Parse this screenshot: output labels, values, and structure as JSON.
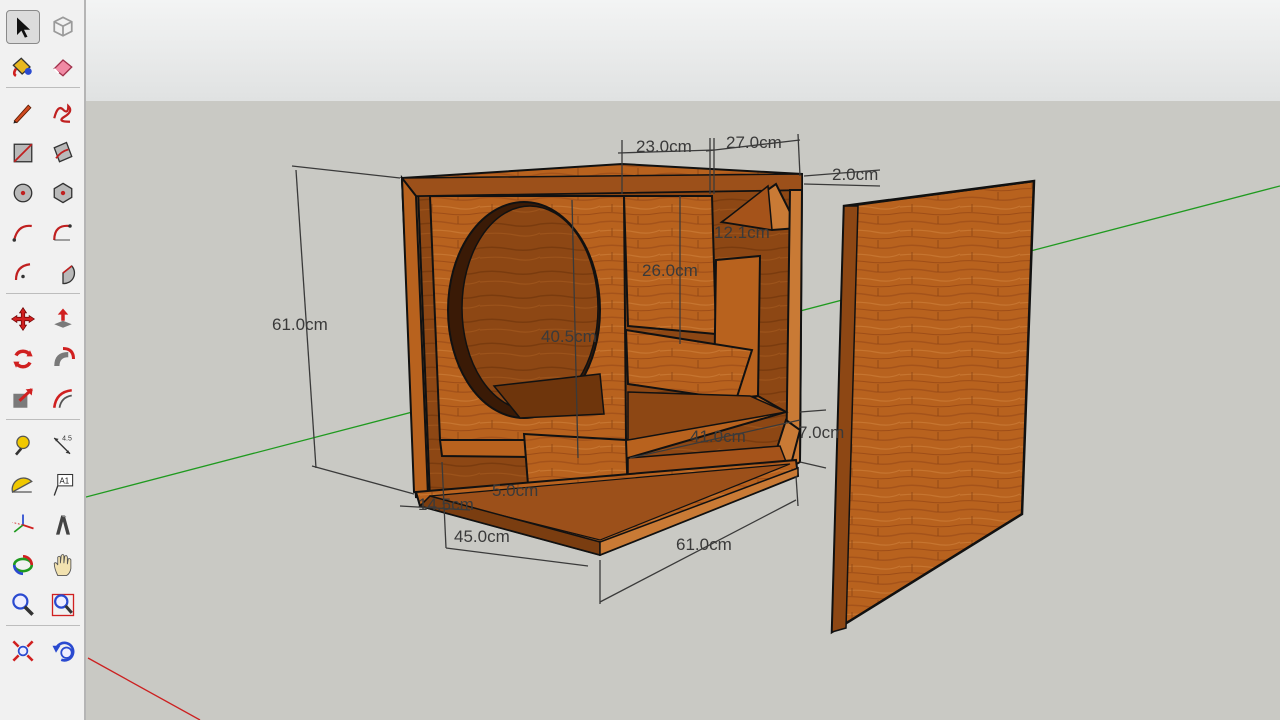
{
  "toolbar": {
    "tools": [
      {
        "id": "select",
        "icon": "select-arrow-icon",
        "selected": true
      },
      {
        "id": "make-component",
        "icon": "make-component-icon",
        "selected": false
      },
      {
        "id": "paint-bucket",
        "icon": "paint-bucket-icon",
        "selected": false
      },
      {
        "id": "eraser",
        "icon": "eraser-icon",
        "selected": false
      },
      {
        "id": "line",
        "icon": "pencil-line-icon",
        "selected": false
      },
      {
        "id": "freehand",
        "icon": "freehand-icon",
        "selected": false
      },
      {
        "id": "rectangle",
        "icon": "rectangle-icon",
        "selected": false
      },
      {
        "id": "rotated-rectangle",
        "icon": "rotated-rectangle-icon",
        "selected": false
      },
      {
        "id": "circle",
        "icon": "circle-icon",
        "selected": false
      },
      {
        "id": "polygon",
        "icon": "polygon-icon",
        "selected": false
      },
      {
        "id": "arc",
        "icon": "arc-icon",
        "selected": false
      },
      {
        "id": "two-point-arc",
        "icon": "two-point-arc-icon",
        "selected": false
      },
      {
        "id": "three-point-arc",
        "icon": "three-point-arc-icon",
        "selected": false
      },
      {
        "id": "pie",
        "icon": "pie-icon",
        "selected": false
      },
      {
        "id": "move",
        "icon": "move-icon",
        "selected": false
      },
      {
        "id": "push-pull",
        "icon": "push-pull-icon",
        "selected": false
      },
      {
        "id": "rotate",
        "icon": "rotate-icon",
        "selected": false
      },
      {
        "id": "follow-me",
        "icon": "follow-me-icon",
        "selected": false
      },
      {
        "id": "scale",
        "icon": "scale-icon",
        "selected": false
      },
      {
        "id": "offset",
        "icon": "offset-icon",
        "selected": false
      },
      {
        "id": "tape-measure",
        "icon": "tape-measure-icon",
        "selected": false
      },
      {
        "id": "dimension",
        "icon": "dimension-icon",
        "selected": false
      },
      {
        "id": "protractor",
        "icon": "protractor-icon",
        "selected": false
      },
      {
        "id": "text",
        "icon": "text-label-icon",
        "label": "A1",
        "selected": false
      },
      {
        "id": "axes",
        "icon": "axes-icon",
        "selected": false
      },
      {
        "id": "3d-text",
        "icon": "3d-text-icon",
        "selected": false
      },
      {
        "id": "orbit",
        "icon": "orbit-icon",
        "selected": false
      },
      {
        "id": "pan",
        "icon": "pan-hand-icon",
        "selected": false
      },
      {
        "id": "zoom",
        "icon": "zoom-icon",
        "selected": false
      },
      {
        "id": "zoom-window",
        "icon": "zoom-window-icon",
        "selected": false
      },
      {
        "id": "zoom-extents",
        "icon": "zoom-extents-icon",
        "selected": false
      },
      {
        "id": "previous-view",
        "icon": "previous-view-icon",
        "selected": false
      }
    ]
  },
  "viewport": {
    "colors": {
      "sky_top": "#f3f4f4",
      "sky_bottom": "#e0e2e2",
      "ground": "#c9c9c4",
      "wood": "#b8621e",
      "wood_dark": "#7a3d10",
      "wood_light": "#c97a35",
      "green_axis": "#1f9a1f",
      "red_axis": "#cc2020",
      "dimension_line": "#3a3a3a"
    },
    "dimensions": {
      "top_width_a": "23.0cm",
      "top_width_b": "27.0cm",
      "panel_gap": "2.0cm",
      "height": "61.0cm",
      "port_depth": "26.0cm",
      "port_small": "12.1cm",
      "baffle_height": "40.5cm",
      "shelf_depth": "41.0cm",
      "side_small": "7.0cm",
      "base_depth": "45.0cm",
      "base_width": "61.0cm",
      "front_small": "14.5cm",
      "inner_small": "5.0cm"
    }
  }
}
